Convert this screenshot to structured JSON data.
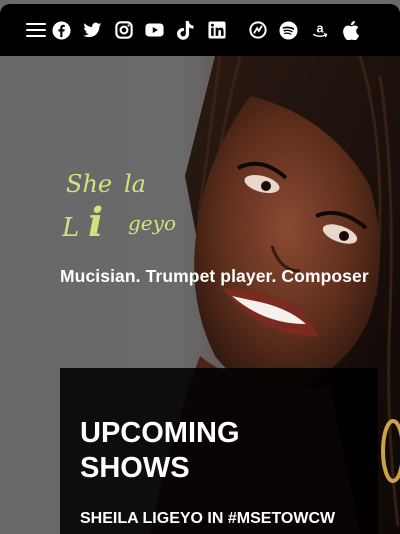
{
  "nav": {
    "menu_icon": "hamburger-menu-icon",
    "social_icons": [
      {
        "name": "facebook-icon"
      },
      {
        "name": "twitter-icon"
      },
      {
        "name": "instagram-icon"
      },
      {
        "name": "youtube-icon"
      },
      {
        "name": "tiktok-icon"
      },
      {
        "name": "linkedin-icon"
      },
      {
        "name": "audiomack-icon"
      },
      {
        "name": "spotify-icon"
      },
      {
        "name": "amazon-icon"
      },
      {
        "name": "apple-icon"
      }
    ]
  },
  "hero": {
    "logo_text": "She la Li geyo",
    "tagline": "Mucisian. Trumpet player. Composer"
  },
  "shows": {
    "title_line1": "UPCOMING",
    "title_line2": "SHOWS",
    "first_show": "SHEILA LIGEYO IN #MSETOWCW"
  },
  "colors": {
    "logo": "#d6e07a",
    "topbar": "#000000",
    "background": "#6a6a6a"
  }
}
